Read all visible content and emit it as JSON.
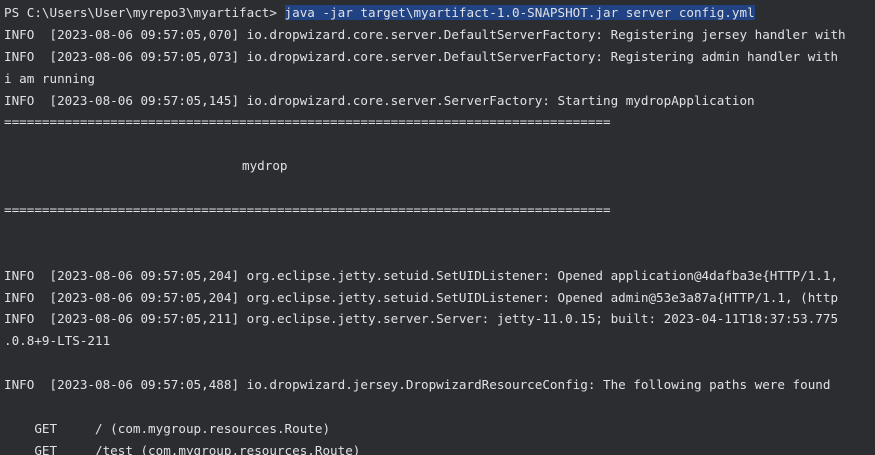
{
  "terminal": {
    "prompt": "PS C:\\Users\\User\\myrepo3\\myartifact> ",
    "command": "java -jar target\\myartifact-1.0-SNAPSHOT.jar server config.yml",
    "lines": [
      "INFO  [2023-08-06 09:57:05,070] io.dropwizard.core.server.DefaultServerFactory: Registering jersey handler with",
      "INFO  [2023-08-06 09:57:05,073] io.dropwizard.core.server.DefaultServerFactory: Registering admin handler with",
      "i am running",
      "INFO  [2023-08-06 09:57:05,145] io.dropwizard.core.server.ServerFactory: Starting mydropApplication",
      "================================================================================",
      "",
      "mydrop",
      "",
      "================================================================================",
      "",
      "",
      "INFO  [2023-08-06 09:57:05,204] org.eclipse.jetty.setuid.SetUIDListener: Opened application@4dafba3e{HTTP/1.1,",
      "INFO  [2023-08-06 09:57:05,204] org.eclipse.jetty.setuid.SetUIDListener: Opened admin@53e3a87a{HTTP/1.1, (http",
      "INFO  [2023-08-06 09:57:05,211] org.eclipse.jetty.server.Server: jetty-11.0.15; built: 2023-04-11T18:37:53.775",
      ".0.8+9-LTS-211",
      "",
      "INFO  [2023-08-06 09:57:05,488] io.dropwizard.jersey.DropwizardResourceConfig: The following paths were found",
      "",
      "    GET     / (com.mygroup.resources.Route)",
      "    GET     /test (com.mygroup.resources.Route)"
    ]
  }
}
